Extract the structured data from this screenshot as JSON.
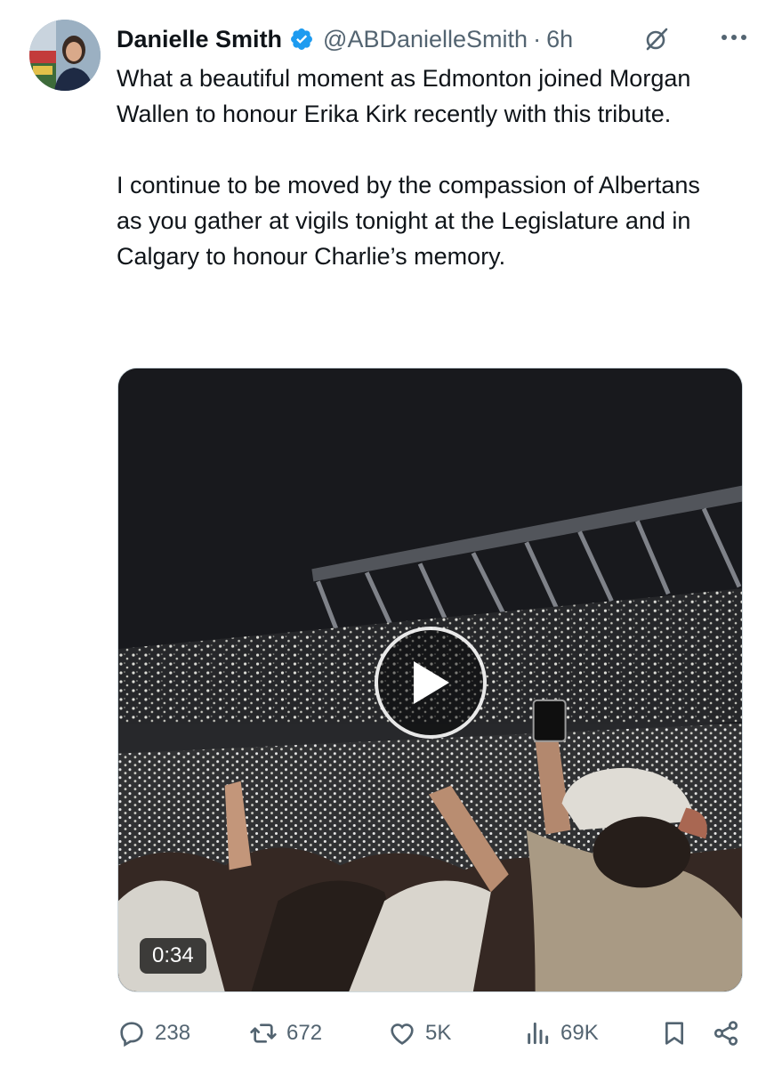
{
  "author": {
    "name": "Danielle Smith",
    "handle": "@ABDanielleSmith",
    "time": "6h",
    "separator": "·"
  },
  "tweet": {
    "paragraphs": [
      "What a beautiful moment as Edmonton joined Morgan Wallen to honour Erika Kirk recently with this tribute.",
      "I continue to be moved by the compassion of Albertans as you gather at vigils tonight at the Legislature and in Calgary to honour Charlie’s memory."
    ]
  },
  "media": {
    "type": "video",
    "duration": "0:34"
  },
  "actions": {
    "replies": "238",
    "reposts": "672",
    "likes": "5K",
    "views": "69K"
  },
  "icons": [
    "verified-badge-icon",
    "grok-icon",
    "more-icon",
    "play-icon",
    "reply-icon",
    "repost-icon",
    "like-icon",
    "views-icon",
    "bookmark-icon",
    "share-icon"
  ],
  "colors": {
    "text": "#0f1419",
    "secondary": "#536471",
    "verified": "#1d9bf0"
  }
}
